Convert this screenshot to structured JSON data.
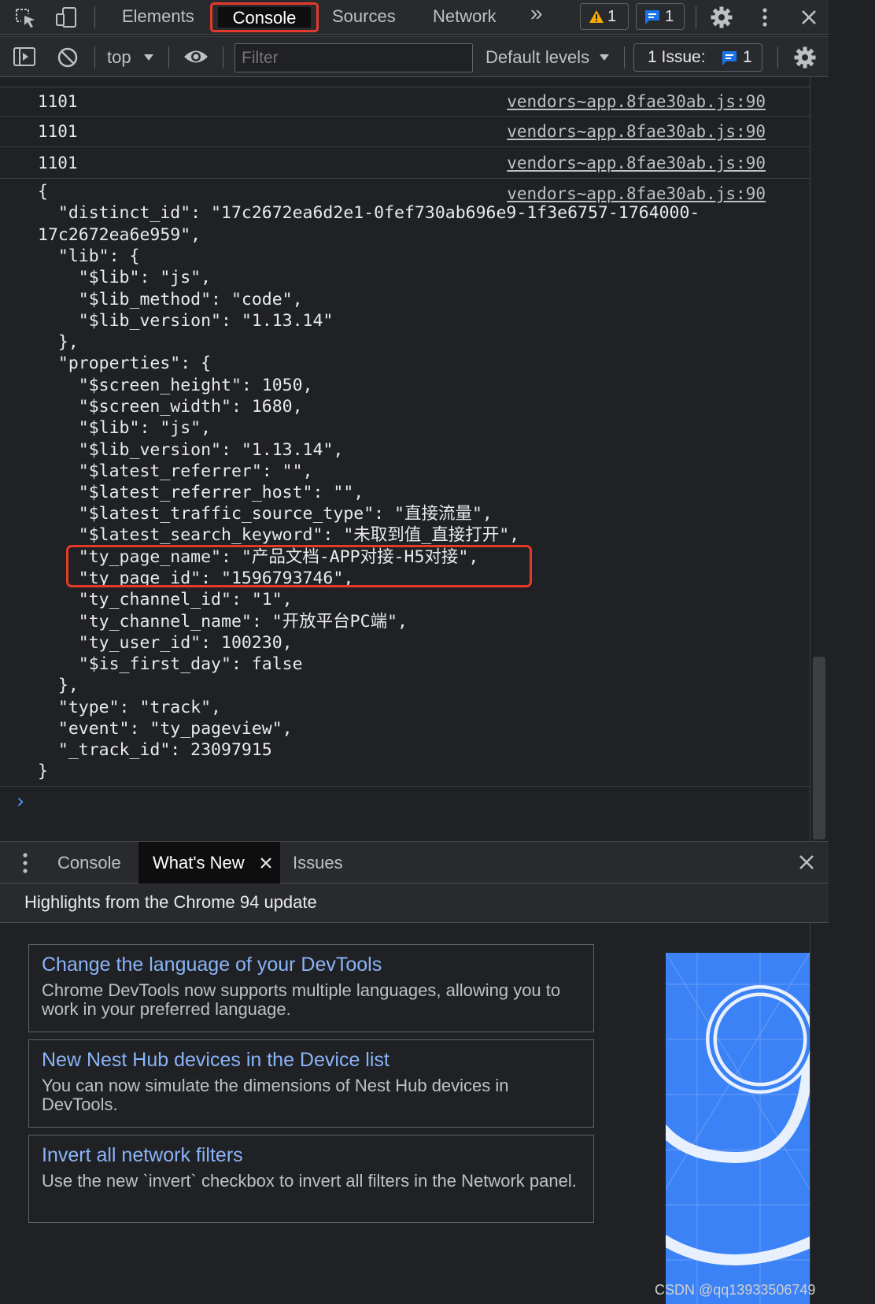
{
  "tabs": {
    "elements": "Elements",
    "console": "Console",
    "sources": "Sources",
    "network": "Network",
    "more": "»",
    "warnings_count": "1",
    "messages_count": "1"
  },
  "toolbar": {
    "context": "top",
    "filter_placeholder": "Filter",
    "levels": "Default levels",
    "issues_label": "1 Issue:",
    "issues_count": "1"
  },
  "console": {
    "messages": [
      {
        "text": "1101",
        "source": "vendors~app.8fae30ab.js:90"
      },
      {
        "text": "1101",
        "source": "vendors~app.8fae30ab.js:90"
      },
      {
        "text": "1101",
        "source": "vendors~app.8fae30ab.js:90"
      }
    ],
    "object_source": "vendors~app.8fae30ab.js:90",
    "object_lines": [
      "{",
      "  \"distinct_id\": \"17c2672ea6d2e1-0fef730ab696e9-1f3e6757-1764000-",
      "17c2672ea6e959\",",
      "  \"lib\": {",
      "    \"$lib\": \"js\",",
      "    \"$lib_method\": \"code\",",
      "    \"$lib_version\": \"1.13.14\"",
      "  },",
      "  \"properties\": {",
      "    \"$screen_height\": 1050,",
      "    \"$screen_width\": 1680,",
      "    \"$lib\": \"js\",",
      "    \"$lib_version\": \"1.13.14\",",
      "    \"$latest_referrer\": \"\",",
      "    \"$latest_referrer_host\": \"\",",
      "    \"$latest_traffic_source_type\": \"直接流量\",",
      "    \"$latest_search_keyword\": \"未取到值_直接打开\",",
      "    \"ty_page_name\": \"产品文档-APP对接-H5对接\",",
      "    \"ty_page_id\": \"1596793746\",",
      "    \"ty_channel_id\": \"1\",",
      "    \"ty_channel_name\": \"开放平台PC端\",",
      "    \"ty_user_id\": 100230,",
      "    \"$is_first_day\": false",
      "  },",
      "  \"type\": \"track\",",
      "  \"event\": \"ty_pageview\",",
      "  \"_track_id\": 23097915",
      "}"
    ],
    "prompt": "›"
  },
  "drawer": {
    "tabs": [
      "Console",
      "What's New",
      "Issues"
    ],
    "highlights": "Highlights from the Chrome 94 update",
    "cards": [
      {
        "title": "Change the language of your DevTools",
        "body": "Chrome DevTools now supports multiple languages, allowing you to work in your preferred language."
      },
      {
        "title": "New Nest Hub devices in the Device list",
        "body": "You can now simulate the dimensions of Nest Hub devices in DevTools."
      },
      {
        "title": "Invert all network filters",
        "body": "Use the new `invert` checkbox to invert all filters in the Network panel."
      }
    ]
  },
  "watermark": "CSDN @qq13933506749",
  "colors": {
    "annotation_red": "#e53a2b",
    "link_blue": "#8ab4f8",
    "prompt_blue": "#4f8ff7",
    "warning_yellow": "#f9ab00",
    "message_blue": "#1a73e8"
  },
  "icons": [
    "inspect-icon",
    "device-toolbar-icon",
    "warning-icon",
    "message-icon",
    "settings-icon",
    "kebab-menu-icon",
    "close-icon",
    "sidebar-toggle-icon",
    "clear-console-icon",
    "eye-icon",
    "dropdown-arrow-icon"
  ]
}
